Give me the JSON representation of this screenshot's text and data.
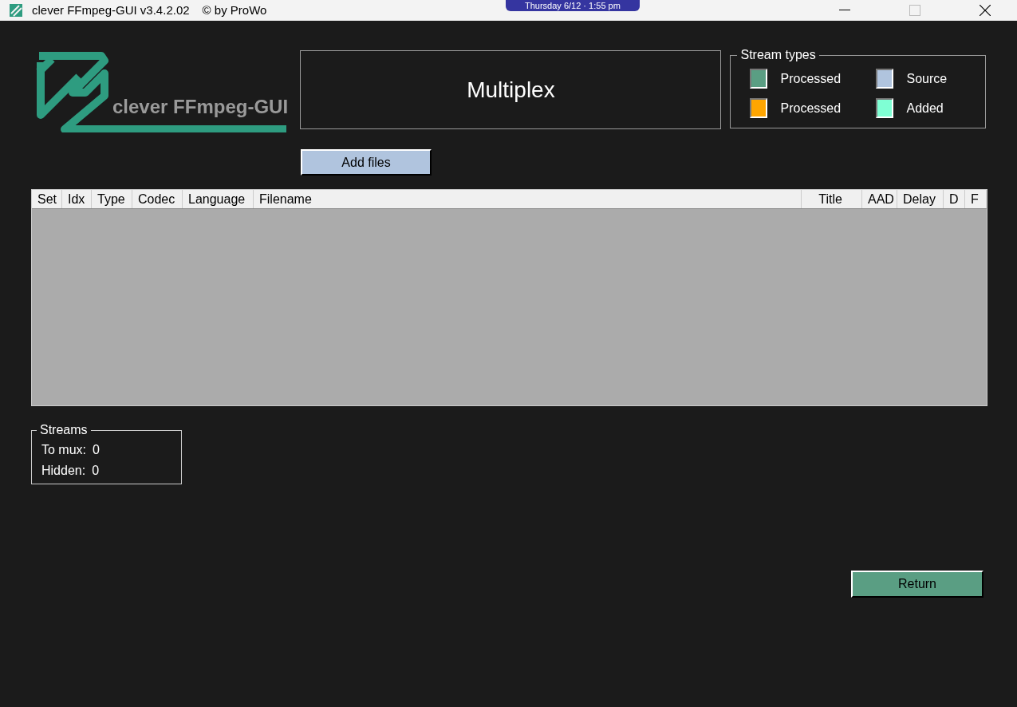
{
  "window": {
    "title": "clever FFmpeg-GUI v3.4.2.02",
    "copyright": "© by ProWo",
    "clock": "Thursday 6/12 · 1:55 pm"
  },
  "logo": {
    "text": "clever FFmpeg-GUI"
  },
  "heading": "Multiplex",
  "stream_types": {
    "title": "Stream types",
    "items": [
      {
        "label": "Processed",
        "color": "#5a9e83"
      },
      {
        "label": "Source",
        "color": "#b0c4de"
      },
      {
        "label": "Processed",
        "color": "#ffa500"
      },
      {
        "label": "Added",
        "color": "#7fffd4"
      }
    ]
  },
  "add_button": "Add files",
  "table": {
    "columns": [
      "Set",
      "Idx",
      "Type",
      "Codec",
      "Language",
      "Filename",
      "Title",
      "AAD",
      "Delay",
      "D",
      "F"
    ]
  },
  "streams": {
    "title": "Streams",
    "rows": [
      {
        "label": "To mux:",
        "value": "0"
      },
      {
        "label": "Hidden:",
        "value": "0"
      }
    ]
  },
  "return_button": "Return"
}
